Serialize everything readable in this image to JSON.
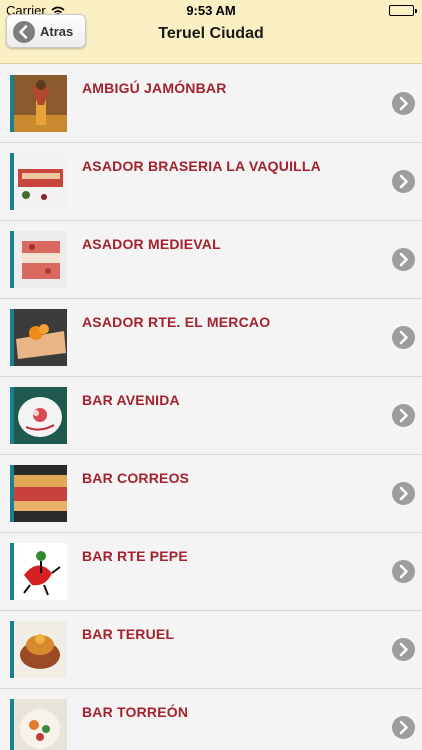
{
  "status_bar": {
    "carrier": "Carrier",
    "time": "9:53 AM"
  },
  "nav": {
    "back_label": "Atras",
    "title": "Teruel Ciudad"
  },
  "restaurants": [
    {
      "name": "AMBIGÚ JAMÓNBAR"
    },
    {
      "name": "ASADOR BRASERIA LA VAQUILLA"
    },
    {
      "name": "ASADOR MEDIEVAL"
    },
    {
      "name": "ASADOR RTE. EL MERCAO"
    },
    {
      "name": "BAR AVENIDA"
    },
    {
      "name": "BAR CORREOS"
    },
    {
      "name": "BAR RTE PEPE"
    },
    {
      "name": "BAR TERUEL"
    },
    {
      "name": "BAR TORREÓN"
    }
  ],
  "colors": {
    "bar_bg": "#fbf0c4",
    "accent": "#1a7f8e",
    "label": "#a3222c",
    "chevron": "#9d9d9d"
  }
}
